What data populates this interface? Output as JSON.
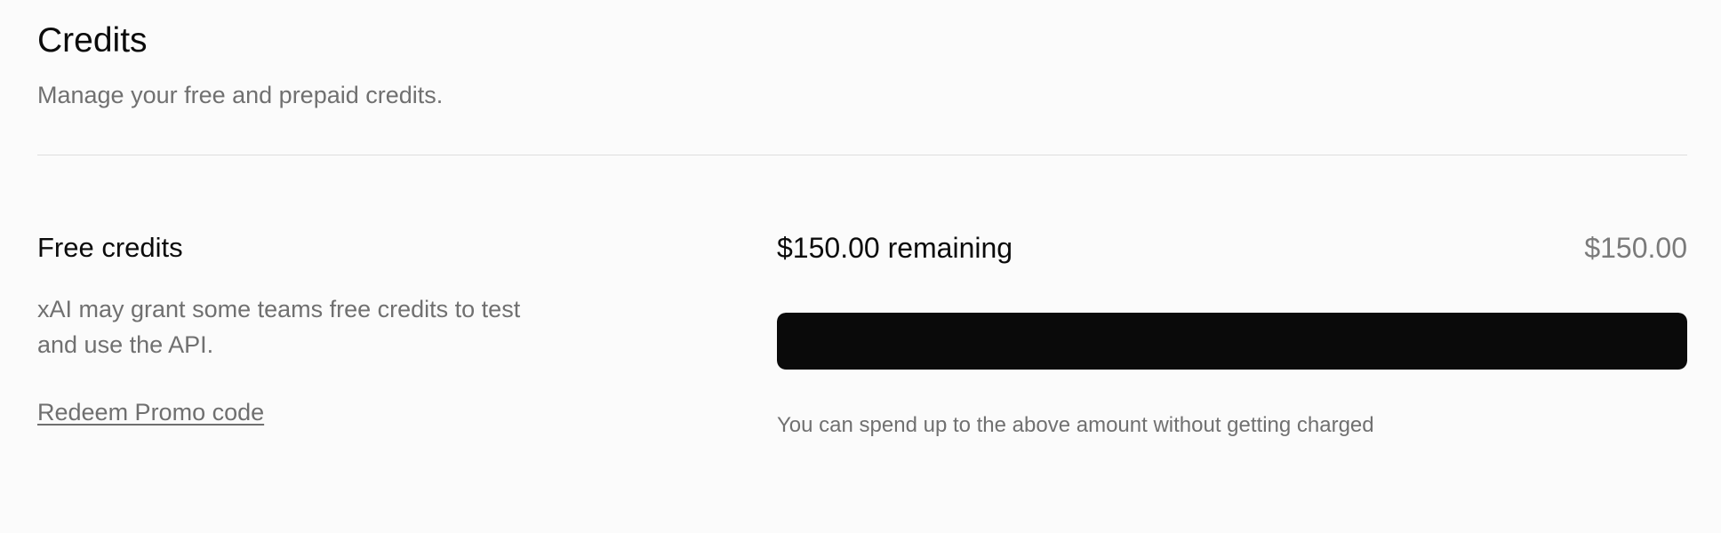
{
  "header": {
    "title": "Credits",
    "subtitle": "Manage your free and prepaid credits."
  },
  "free_credits": {
    "title": "Free credits",
    "description": "xAI may grant some teams free credits to test and use the API.",
    "promo_link": "Redeem Promo code",
    "remaining_label": "$150.00 remaining",
    "total_amount": "$150.00",
    "progress_fraction": 1.0,
    "help_text": "You can spend up to the above amount without getting charged"
  },
  "colors": {
    "background": "#fbfbfb",
    "progress_fill": "#0a0a0a",
    "muted_text": "#707070"
  }
}
